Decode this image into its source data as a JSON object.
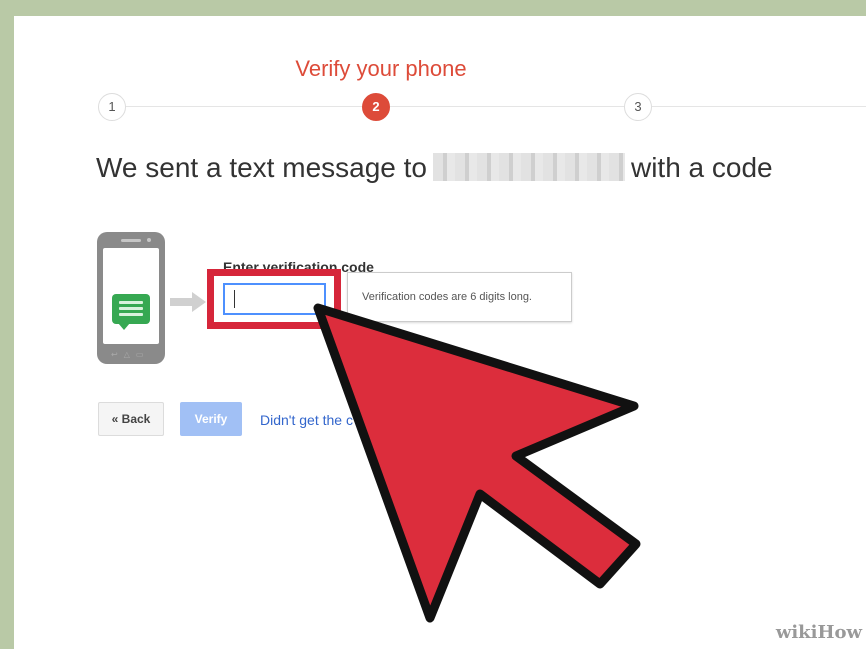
{
  "stepper": {
    "title": "Verify your phone",
    "steps": [
      "1",
      "2",
      "3"
    ],
    "active_step": 2
  },
  "headline": {
    "prefix": "We sent a text message to",
    "suffix": "with a code"
  },
  "verification": {
    "label": "Enter verification code",
    "input_value": "",
    "hint": "Verification codes are 6 digits long."
  },
  "buttons": {
    "back_label": "« Back",
    "verify_label": "Verify",
    "resend_link": "Didn't get the c"
  },
  "watermark": "wikiHow",
  "icons": [
    "phone-illustration-icon",
    "chat-bubble-icon",
    "right-arrow-icon",
    "mouse-cursor-icon"
  ],
  "colors": {
    "accent_red": "#dd4b39",
    "highlight_red": "#d6263a",
    "verify_blue": "#a1c0f5",
    "link_blue": "#3366cc",
    "chat_green": "#36a852"
  }
}
